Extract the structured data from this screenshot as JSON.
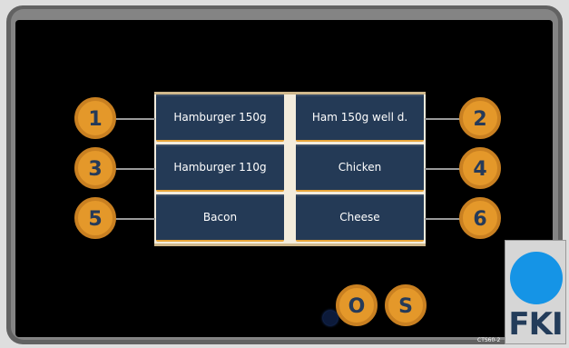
{
  "buttons": [
    {
      "number": "1",
      "label": "Hamburger 150g"
    },
    {
      "number": "2",
      "label": "Ham 150g well d."
    },
    {
      "number": "3",
      "label": "Hamburger 110g"
    },
    {
      "number": "4",
      "label": "Chicken"
    },
    {
      "number": "5",
      "label": "Bacon"
    },
    {
      "number": "6",
      "label": "Cheese"
    }
  ],
  "controls": {
    "o_label": "O",
    "s_label": "S"
  },
  "logo": {
    "text": "FKI",
    "circle_color": "#1594e6"
  },
  "reference_code": "CTS60-2",
  "colors": {
    "accent": "#e4982a",
    "cell_bg": "#243a56",
    "screen_bg": "#000000"
  }
}
